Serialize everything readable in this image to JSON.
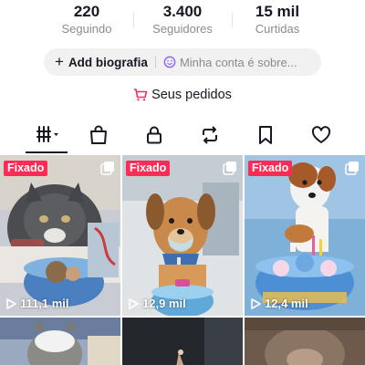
{
  "stats": [
    {
      "value": "220",
      "label": "Seguindo"
    },
    {
      "value": "3.400",
      "label": "Seguidores"
    },
    {
      "value": "15 mil",
      "label": "Curtidas"
    }
  ],
  "bio": {
    "add_label": "Add biografia",
    "prompt": "Minha conta é sobre..."
  },
  "orders": {
    "label": "Seus pedidos",
    "icon": "cart-icon",
    "color": "#fe2c55"
  },
  "tabs": [
    {
      "icon": "grid-icon",
      "active": true
    },
    {
      "icon": "shopping-bag-icon"
    },
    {
      "icon": "lock-icon"
    },
    {
      "icon": "repost-icon"
    },
    {
      "icon": "bookmark-icon"
    },
    {
      "icon": "heart-icon"
    }
  ],
  "videos": [
    {
      "pinned": "Fixado",
      "views": "111,1 mil"
    },
    {
      "pinned": "Fixado",
      "views": "12,9 mil"
    },
    {
      "pinned": "Fixado",
      "views": "12,4 mil"
    },
    {},
    {},
    {}
  ],
  "colors": {
    "accent": "#fe2c55",
    "text": "#161823",
    "secondary": "#8a8b91"
  }
}
